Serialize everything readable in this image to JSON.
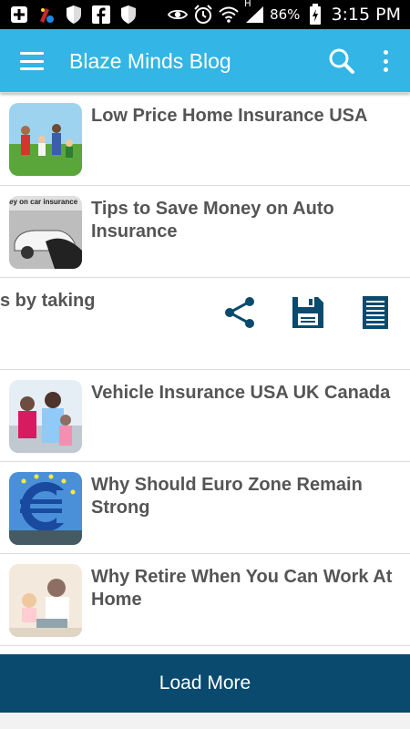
{
  "status_bar": {
    "battery_pct": "86%",
    "time": "3:15 PM",
    "network": "H"
  },
  "app_bar": {
    "title": "Blaze Minds Blog"
  },
  "posts": [
    {
      "title": "Low Price Home Insurance USA"
    },
    {
      "title": "Tips to Save Money on Auto Insurance",
      "thumb_caption": "ey on car insurance"
    },
    {
      "title": "s by taking"
    },
    {
      "title": "Vehicle Insurance USA UK Canada"
    },
    {
      "title": "Why Should Euro Zone Remain Strong"
    },
    {
      "title": "Why Retire When You Can Work At Home"
    }
  ],
  "load_more": {
    "label": "Load More"
  },
  "colors": {
    "app_bar": "#33b5e5",
    "load_more": "#0a4a6e",
    "action_icons": "#0a4a6e",
    "title_text": "#555555"
  }
}
